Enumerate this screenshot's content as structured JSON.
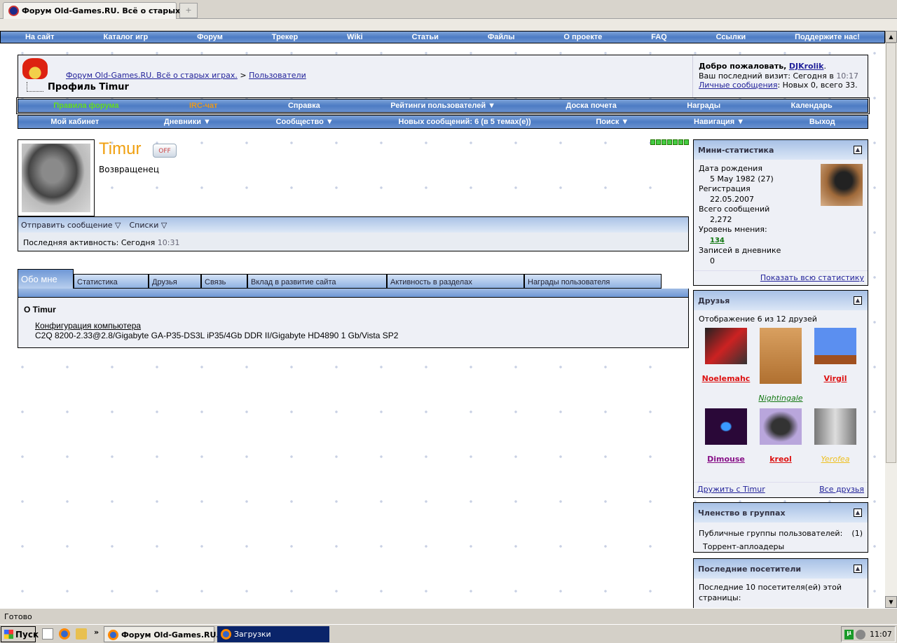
{
  "browser": {
    "tab_title": "Форум Old-Games.RU. Всё о старых...",
    "new_tab": "+"
  },
  "topnav": [
    "На сайт",
    "Каталог игр",
    "Форум",
    "Трекер",
    "Wiki",
    "Статьи",
    "Файлы",
    "О проекте",
    "FAQ",
    "Ссылки",
    "Поддержите нас!"
  ],
  "header": {
    "crumb_root": "Форум Old-Games.RU. Всё о старых играх.",
    "crumb_sep": ">",
    "crumb_users": "Пользователи",
    "page_title": "Профиль Timur",
    "welcome": "Добро пожаловать,",
    "welcome_user": "DJKrolik",
    "last_visit": "Ваш последний визит: Сегодня в",
    "last_visit_time": "10:17",
    "pm_link": "Личные сообщения",
    "pm_status": ": Новых 0, всего 33."
  },
  "nav1": [
    {
      "label": "Правила форума",
      "color": "#66dd22"
    },
    {
      "label": "IRC-чат",
      "color": "#e89a20"
    },
    {
      "label": "Справка"
    },
    {
      "label": "Рейтинги пользователей ▼"
    },
    {
      "label": "Доска почета"
    },
    {
      "label": "Награды"
    },
    {
      "label": "Календарь"
    }
  ],
  "nav2": [
    "Мой кабинет",
    "Дневники ▼",
    "Сообщество ▼",
    "Новых сообщений: 6 (в 5 темах(е))",
    "Поиск ▼",
    "Навигация ▼",
    "Выход"
  ],
  "profile": {
    "username": "Timur",
    "status_badge": "OFF",
    "user_title": "Возвращенец",
    "send_message": "Отправить сообщение ▽",
    "lists": "Списки ▽",
    "last_activity": "Последняя активность: Сегодня",
    "last_activity_time": "10:31",
    "reputation_segments": 7
  },
  "tabs": [
    "Обо мне",
    "Статистика",
    "Друзья",
    "Связь",
    "Вклад в развитие сайта",
    "Активность в разделах",
    "Награды пользователя"
  ],
  "about": {
    "heading": "О Timur",
    "field_label": "Конфигурация компьютера",
    "field_value": "C2Q 8200-2.33@2.8/Gigabyte GA-P35-DS3L iP35/4Gb DDR II/Gigabyte HD4890 1 Gb/Vista SP2"
  },
  "ministats": {
    "title": "Мини-статистика",
    "birth_label": "Дата рождения",
    "birth": "5 May 1982 (27)",
    "reg_label": "Регистрация",
    "reg": "22.05.2007",
    "posts_label": "Всего сообщений",
    "posts": "2,272",
    "rep_label": "Уровень мнения:",
    "rep": "134",
    "diary_label": "Записей в дневнике",
    "diary": "0",
    "show_all": "Показать всю статистику"
  },
  "friends": {
    "title": "Друзья",
    "showing": "Отображение 6 из 12 друзей",
    "list": [
      {
        "name": "Noelemahc",
        "color": "#dd1111"
      },
      {
        "name": "Nightingale",
        "color": "#117711"
      },
      {
        "name": "Virgil",
        "color": "#dd1111"
      },
      {
        "name": "Dimouse",
        "color": "#881188"
      },
      {
        "name": "kreol",
        "color": "#dd1111"
      },
      {
        "name": "Yerofea",
        "color": "#eec020"
      }
    ],
    "befriend": "Дружить с Timur",
    "all": "Все друзья"
  },
  "groups": {
    "title": "Членство в группах",
    "public": "Публичные группы пользователей:",
    "count": "(1)",
    "group": "Торрент-аплоадеры"
  },
  "visitors": {
    "title": "Последние посетители",
    "text": "Последние 10 посетителя(ей) этой страницы:"
  },
  "statusbar": "Готово",
  "taskbar": {
    "start": "Пуск",
    "task1": "Форум Old-Games.RU...",
    "task2": "Загрузки",
    "clock": "11:07",
    "chevron": "»"
  }
}
